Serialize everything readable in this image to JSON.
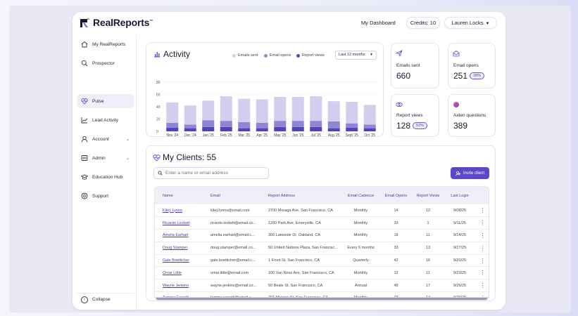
{
  "header": {
    "logo_text": "RealReports",
    "logo_tm": "™",
    "dashboard_link": "My Dashboard",
    "credits": "Credits: 10",
    "user_name": "Lauren Locks"
  },
  "sidebar": {
    "items": [
      {
        "label": "My RealReports",
        "icon": "home-icon"
      },
      {
        "label": "Prospector",
        "icon": "search-icon"
      },
      {
        "label": "Pulse",
        "icon": "heart-pulse-icon",
        "active": true
      },
      {
        "label": "Lead Activity",
        "icon": "chart-line-icon"
      },
      {
        "label": "Account",
        "icon": "user-icon",
        "chevron": true
      },
      {
        "label": "Admin",
        "icon": "admin-icon",
        "chevron": true
      },
      {
        "label": "Education Hub",
        "icon": "graduation-cap-icon"
      },
      {
        "label": "Support",
        "icon": "support-icon"
      }
    ],
    "collapse_label": "Collapse"
  },
  "activity": {
    "title": "Activity",
    "legend": [
      "Emails sent",
      "Email opens",
      "Report views"
    ],
    "range": "Last 12 months"
  },
  "chart_data": {
    "type": "bar",
    "stacked": true,
    "categories": [
      "Nov '24",
      "Dec '24",
      "Jan '25",
      "Feb '25",
      "Mar '25",
      "Apr '25",
      "May '25",
      "Jun '25",
      "Jul '25",
      "Aug '25",
      "Sept '25",
      "Oct '25"
    ],
    "series": [
      {
        "name": "Report views",
        "color": "#5243b8",
        "values": [
          6,
          5,
          7,
          7,
          5,
          5,
          7,
          7,
          7,
          5,
          6,
          5
        ]
      },
      {
        "name": "Email opens",
        "color": "#8f86d8",
        "values": [
          8,
          6,
          11,
          10,
          10,
          9,
          10,
          10,
          10,
          11,
          7,
          6
        ]
      },
      {
        "name": "Emails sent",
        "color": "#d2cfee",
        "values": [
          33,
          31,
          32,
          40,
          38,
          38,
          39,
          39,
          40,
          33,
          35,
          32
        ]
      }
    ],
    "yticks": [
      0,
      20,
      40,
      60,
      80
    ],
    "ylim": [
      0,
      80
    ],
    "grid": true
  },
  "stats": {
    "emails_sent": {
      "label": "Emails sent",
      "value": "660"
    },
    "email_opens": {
      "label": "Email opens",
      "value": "251",
      "badge": "38%"
    },
    "report_views": {
      "label": "Report views",
      "value": "128",
      "badge": "52%"
    },
    "aiden_questions": {
      "label": "Aiden questions",
      "value": "389"
    }
  },
  "clients": {
    "title": "My Clients: 55",
    "search_placeholder": "Enter a name or email address",
    "invite_label": "Invite client",
    "columns": [
      "Name",
      "Email",
      "Report Address",
      "Email Cadence",
      "Email Opens",
      "Report Views",
      "Last Login"
    ],
    "rows": [
      [
        "Kiley Lyons",
        "kiley.lyons@email.com",
        "2700 Moraga Ave, San Francisco, CA",
        "Monthly",
        "14",
        "12",
        "9/08/25"
      ],
      [
        "Ricardo Lockett",
        "ricardo.lockett@email.co...",
        "1200 Park Ave, Emeryville, CA",
        "Monthly",
        "33",
        "1",
        "9/11/25"
      ],
      [
        "Amelia Earhart",
        "amelia.earhart@email.c...",
        "300 Lakeside Dr, Oakland, CA",
        "Monthly",
        "18",
        "11",
        "9/14/25"
      ],
      [
        "Doug Stamper",
        "doug.stamper@email.co...",
        "50 United Nations Plaza, San Francisc...",
        "Every 6 months",
        "33",
        "13",
        "9/17/25"
      ],
      [
        "Gale Boetticher",
        "gale.boetticher@email.c...",
        "1 Front St, San Francisco, CA",
        "Quarterly",
        "42",
        "16",
        "9/20/25"
      ],
      [
        "Omar Little",
        "omar.little@email.com",
        "100 Van Ness Ave, San Francisco, CA",
        "Monthly",
        "12",
        "11",
        "9/23/25"
      ],
      [
        "Wayne Jenkins",
        "wayne.jenkins@email.co...",
        "50 Beale St, San Francisco, CA",
        "Annual",
        "48",
        "17",
        "9/26/25"
      ],
      [
        "Tammy Carretti",
        "tammy.carretti@email.c...",
        "201 Mission St, San Francisco, CA",
        "Monthly",
        "23",
        "14",
        "9/29/25"
      ]
    ]
  }
}
